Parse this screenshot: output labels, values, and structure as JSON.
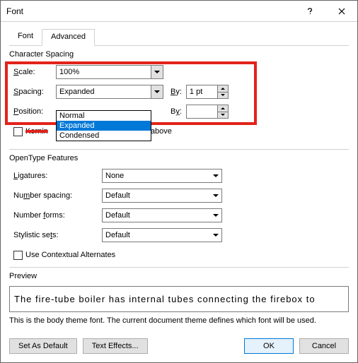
{
  "window": {
    "title": "Font"
  },
  "tabs": {
    "font": "Font",
    "advanced": "Advanced"
  },
  "char_spacing": {
    "title": "Character Spacing",
    "scale_label": "Scale:",
    "scale_value": "100%",
    "spacing_label": "Spacing:",
    "spacing_value": "Expanded",
    "spacing_options": {
      "normal": "Normal",
      "expanded": "Expanded",
      "condensed": "Condensed"
    },
    "by_label": "By:",
    "by_value": "1 pt",
    "position_label": "Position:",
    "position_by_label": "By:",
    "kerning_label": "Kerning for fonts:",
    "kerning_suffix": "Points and above"
  },
  "opentype": {
    "title": "OpenType Features",
    "ligatures_label": "Ligatures:",
    "ligatures_value": "None",
    "num_spacing_label": "Number spacing:",
    "num_spacing_value": "Default",
    "num_forms_label": "Number forms:",
    "num_forms_value": "Default",
    "stylistic_label": "Stylistic sets:",
    "stylistic_value": "Default",
    "contextual_label": "Use Contextual Alternates"
  },
  "preview": {
    "title": "Preview",
    "text": "The fire-tube boiler has internal tubes connecting the firebox to",
    "hint": "This is the body theme font. The current document theme defines which font will be used."
  },
  "footer": {
    "set_default": "Set As Default",
    "text_effects": "Text Effects...",
    "ok": "OK",
    "cancel": "Cancel"
  }
}
